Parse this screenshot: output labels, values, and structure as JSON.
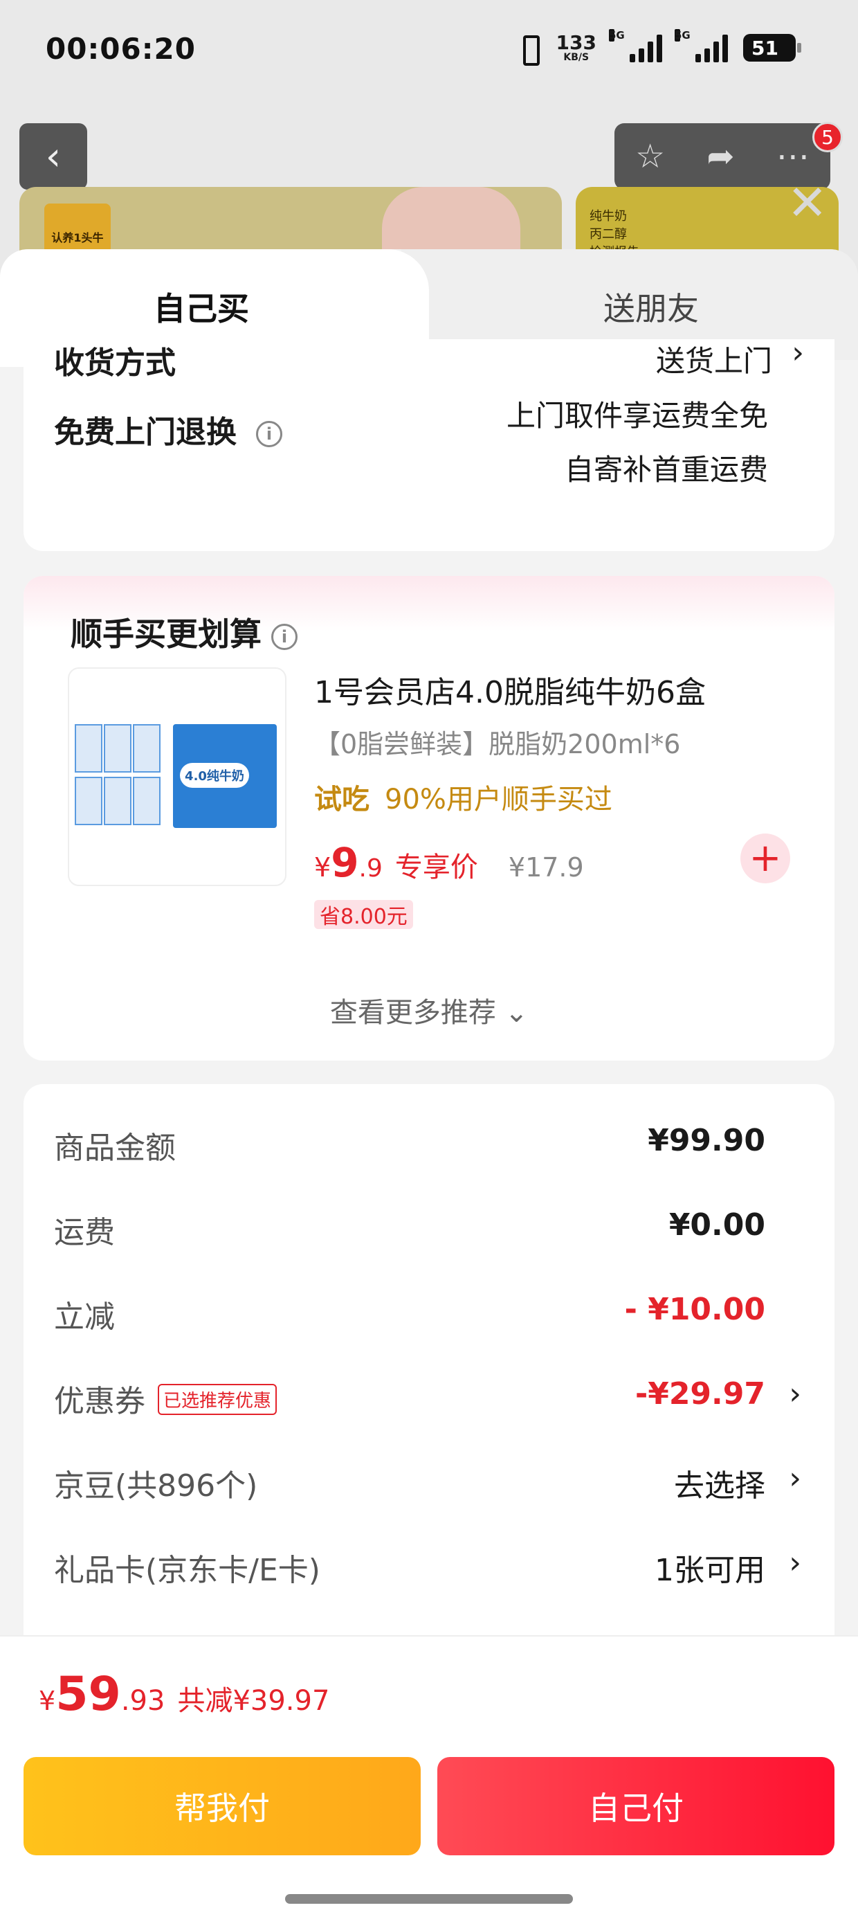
{
  "status_bar": {
    "time": "00:06:20",
    "net_speed_value": "133",
    "net_speed_unit": "KB/S",
    "sim1": "5G",
    "sim2": "5G",
    "battery": "51"
  },
  "nav": {
    "back_icon": "back-icon",
    "badge_count": "5"
  },
  "banner": {
    "left_badge": "认养1头牛",
    "right_text": "纯牛奶\n丙二醇\n检测报告"
  },
  "tabs": [
    {
      "label": "自己买",
      "active": true
    },
    {
      "label": "送朋友",
      "active": false
    }
  ],
  "delivery": {
    "method_label": "收货方式",
    "method_value": "送货上门",
    "return_label": "免费上门退换",
    "return_value_line1": "上门取件享运费全免",
    "return_value_line2": "自寄补首重运费"
  },
  "addon": {
    "title": "顺手买更划算",
    "product": {
      "name": "1号会员店4.0脱脂纯牛奶6盒",
      "spec": "【0脂尝鲜装】脱脂奶200ml*6",
      "tag_bold": "试吃",
      "tag_text": "90%用户顺手买过",
      "price_currency": "¥",
      "price_int": "9",
      "price_dec": ".9",
      "price_label": "专享价",
      "original_price": "¥17.9",
      "save_text": "省8.00元",
      "image_label": "4.0纯牛奶"
    },
    "see_more": "查看更多推荐 ⌄"
  },
  "summary": {
    "rows": [
      {
        "label": "商品金额",
        "value": "¥99.90"
      },
      {
        "label": "运费",
        "value": "¥0.00"
      },
      {
        "label": "立减",
        "value": "- ¥10.00"
      },
      {
        "label": "优惠券",
        "tag": "已选推荐优惠",
        "value": "-¥29.97"
      },
      {
        "label": "京豆(共896个)",
        "value": "去选择"
      },
      {
        "label": "礼品卡(京东卡/E卡)",
        "value": "1张可用"
      }
    ]
  },
  "bottom": {
    "currency": "¥",
    "total_int": "59",
    "total_dec": ".93",
    "discount_text": "共减¥39.97",
    "btn_friend": "帮我付",
    "btn_self": "自己付"
  },
  "colors": {
    "price_red": "#e4232b",
    "accent_yellow": "#ffb81a",
    "tag_gold": "#c58a11"
  }
}
